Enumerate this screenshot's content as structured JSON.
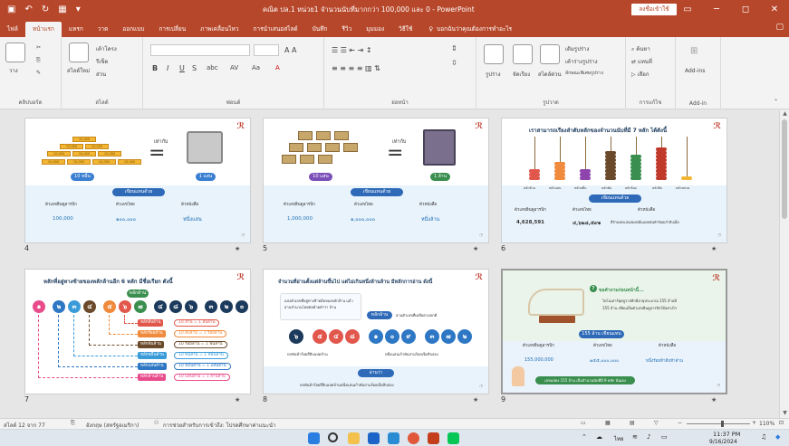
{
  "window": {
    "title": "คณิต ปล.1 หน่วย1 จำนวนนับที่มากกว่า 100,000 และ 0  -  PowerPoint",
    "signin": "ลงชื่อเข้าใช้"
  },
  "tabs": [
    "ไฟล์",
    "หน้าแรก",
    "แทรก",
    "วาด",
    "ออกแบบ",
    "การเปลี่ยน",
    "ภาพเคลื่อนไหว",
    "การนำเสนอสไลด์",
    "บันทึก",
    "รีวิว",
    "มุมมอง",
    "วิธีใช้"
  ],
  "tellme": "บอกฉันว่าคุณต้องการทำอะไร",
  "ribbon": {
    "clipboard": {
      "label": "คลิปบอร์ด",
      "paste": "วาง"
    },
    "slides": {
      "label": "สไลด์",
      "new": "สไลด์ใหม่",
      "layout": "เค้าโครง",
      "reset": "รีเซ็ต",
      "section": "ส่วน"
    },
    "font": {
      "label": "ฟอนต์"
    },
    "paragraph": {
      "label": "ย่อหน้า"
    },
    "drawing": {
      "label": "รูปวาด",
      "shapes": "รูปร่าง",
      "arrange": "จัดเรียง",
      "quick": "สไตล์ด่วน",
      "fill": "เติมรูปร่าง",
      "outline": "เค้าร่างรูปร่าง",
      "effects": "ลักษณะพิเศษรูปร่าง"
    },
    "editing": {
      "label": "การแก้ไข",
      "find": "ค้นหา",
      "replace": "แทนที่",
      "select": "เลือก"
    },
    "addin": {
      "label": "Add-in",
      "btn": "Add-ins"
    }
  },
  "slides": [
    {
      "num": "4",
      "left_caption": "10 หมื่น",
      "right_caption": "1 แสน",
      "equals": "=",
      "same": "เท่ากับ",
      "band": "เขียนแทนด้วย",
      "h1": "ตัวเลขฮินดูอารบิก",
      "h2": "ตัวเลขไทย",
      "h3": "ตัวหนังสือ",
      "v1": "100,000",
      "v2": "๑๐๐,๐๐๐",
      "v3": "หนึ่งแสน"
    },
    {
      "num": "5",
      "left_caption": "10 แสน",
      "right_caption": "1 ล้าน",
      "equals": "=",
      "same": "เท่ากับ",
      "band": "เขียนแทนด้วย",
      "h1": "ตัวเลขฮินดูอารบิก",
      "h2": "ตัวเลขไทย",
      "h3": "ตัวหนังสือ",
      "v1": "1,000,000",
      "v2": "๑,๐๐๐,๐๐๐",
      "v3": "หนึ่งล้าน"
    },
    {
      "num": "6",
      "title": "เราสามารถเรียงลำดับหลักของจำนวนนับที่มี 7 หลัก ได้ดังนี้",
      "places": [
        "หลักล้าน",
        "หลักแสน",
        "หลักหมื่น",
        "หลักพัน",
        "หลักร้อย",
        "หลักสิบ",
        "หลักหน่วย"
      ],
      "band": "เขียนแทนด้วย",
      "h1": "ตัวเลขฮินดูอารบิก",
      "h2": "ตัวเลขไทย",
      "h3": "ตัวหนังสือ",
      "v1": "4,628,591",
      "v2": "๔,๖๒๘,๕๙๑",
      "v3": "สี่ล้านหกแสนสองหมื่นแปดพันห้าร้อยเก้าสิบเอ็ด"
    },
    {
      "num": "7",
      "title": "หลักที่อยู่ทางซ้ายของหลักล้านอีก 6 หลัก มีชื่อเรียก ดังนี้",
      "tag": "หลักล้าน",
      "digits": [
        "๑",
        "๒",
        "๓",
        "๔",
        "๕",
        "๖",
        "๗",
        "๔",
        "๘",
        "๖",
        "๓",
        "๒",
        "๐"
      ],
      "rows": [
        {
          "l": "หลักสิบล้าน",
          "v": "10 ล้าน = 1 สิบล้าน",
          "c": "#e2574c"
        },
        {
          "l": "หลักร้อยล้าน",
          "v": "10 สิบล้าน = 1 ร้อยล้าน",
          "c": "#f08a3c"
        },
        {
          "l": "หลักพันล้าน",
          "v": "10 ร้อยล้าน = 1 พันล้าน",
          "c": "#6b4a2b"
        },
        {
          "l": "หลักหมื่นล้าน",
          "v": "10 พันล้าน = 1 หมื่นล้าน",
          "c": "#3a9bd9"
        },
        {
          "l": "หลักแสนล้าน",
          "v": "10 หมื่นล้าน = 1 แสนล้าน",
          "c": "#2d77c4"
        },
        {
          "l": "หลักล้านล้าน",
          "v": "10 แสนล้าน = 1 ล้านล้าน",
          "c": "#e84c8a"
        }
      ]
    },
    {
      "num": "8",
      "title": "จำนวนที่อ่านตั้งแต่ล้านขึ้นไป แต่ไม่เกินหนึ่งล้านล้าน มีหลักการอ่าน ดังนี้",
      "note": "แบ่งตัวเลขที่อยู่ทางซ้ายมือของหลักล้าน แล้วอ่านจำนวนโดยต่อด้วยคำว่า ล้าน",
      "tag": "หลักล้าน",
      "tag2": "อ่านตัวเลขที่เหลือตามปกติ",
      "digits": [
        "๖",
        "๕",
        "๔",
        "๘",
        "๑",
        "๐",
        "๙",
        "๓",
        "๗",
        "๒"
      ],
      "foot1": "หกพันห้าร้อยสี่สิบแปดล้าน",
      "foot2": "หนึ่งแสนเก้าพันสามร้อยเจ็ดสิบสอง",
      "band": "อ่านว่า",
      "read": "หกพันห้าร้อยสี่สิบแปดล้านหนึ่งแสนเก้าพันสามร้อยเจ็ดสิบสอง"
    },
    {
      "num": "9",
      "title": "ขอคำถามก่อนหน้านี้...",
      "q": "ไดโนเสาร์ยุคจูราสสิกมีอายุประมาณ 155 ล้านปี",
      "q2": "155 ล้าน เขียนเป็นตัวเลขฮินดูอารบิกได้อย่างไร",
      "band": "155 ล้าน เขียนแทนด้วย",
      "h1": "ตัวเลขฮินดูอารบิก",
      "h2": "ตัวเลขไทย",
      "h3": "ตัวหนังสือ",
      "v1": "155,000,000",
      "v2": "๑๕๕,๐๐๐,๐๐๐",
      "v3": "หนึ่งร้อยห้าสิบห้าล้าน",
      "answer": "เลขแสดง 155 ล้าน เป็นจำนวนนับที่มี 9 หลัก นั่นเอง"
    }
  ],
  "status": {
    "slide": "สไลด์ 12 จาก 77",
    "lang": "อังกฤษ (สหรัฐอเมริกา)",
    "access": "การช่วยสำหรับการเข้าถึง: โปรดศึกษาค่าแนะนำ",
    "zoom": "110%"
  },
  "taskbar": {
    "time": "11:37 PM",
    "date": "9/16/2024",
    "lang": "ไทย"
  }
}
